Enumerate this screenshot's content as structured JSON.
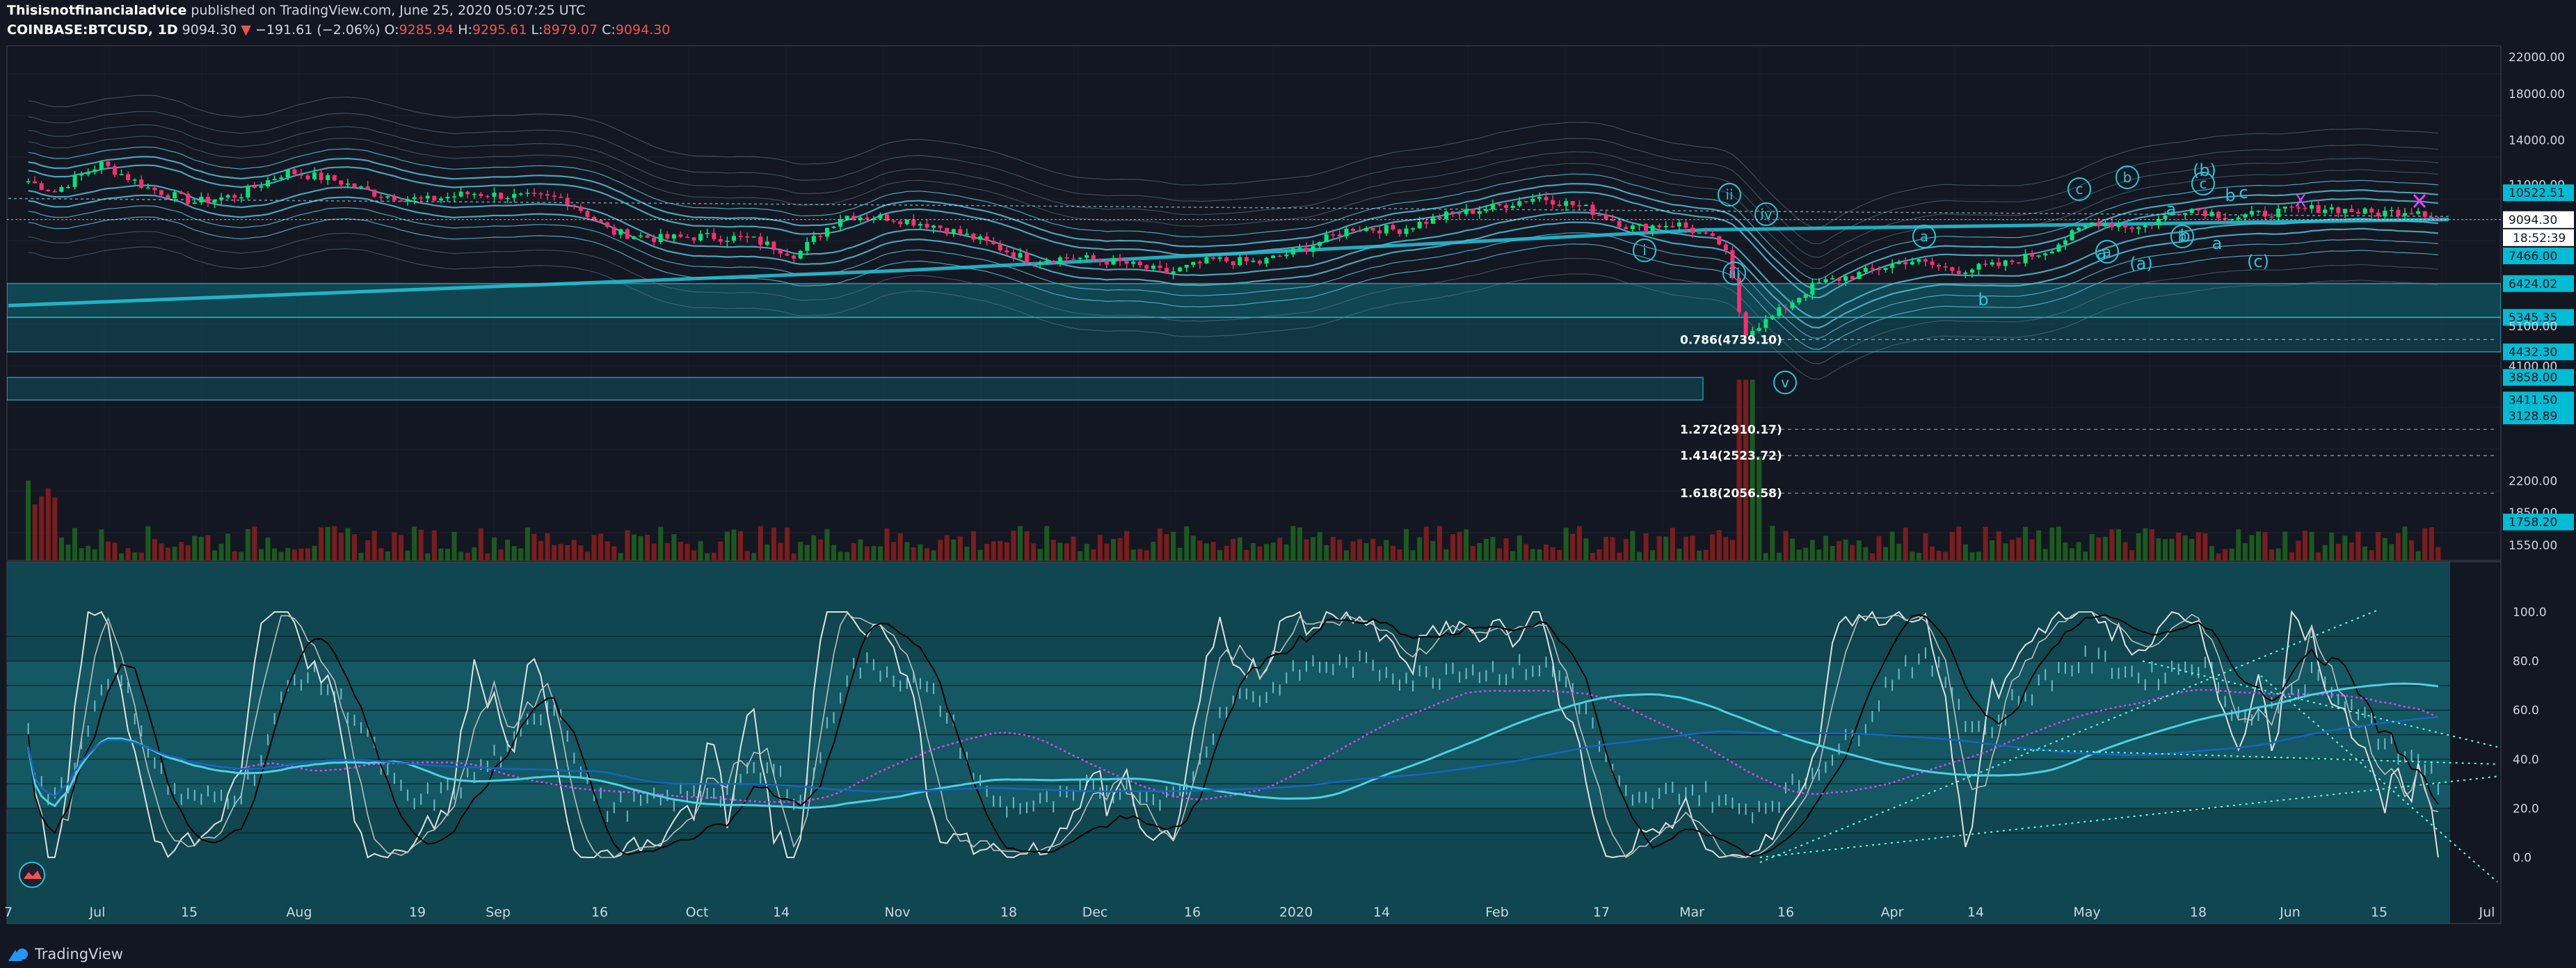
{
  "header": {
    "author": "Thisisnotfinancialadvice",
    "published": "published on TradingView.com, June 25, 2020 05:07:25 UTC",
    "symbol": "COINBASE:BTCUSD, 1D",
    "last": "9094.30",
    "change": "−191.61 (−2.06%)",
    "o_label": "O:",
    "o_val": "9285.94",
    "h_label": "H:",
    "h_val": "9295.61",
    "l_label": "L:",
    "l_val": "8979.07",
    "c_label": "C:",
    "c_val": "9094.30",
    "down_arrow": "▼"
  },
  "footer": {
    "brand": "TradingView"
  },
  "colors": {
    "background": "#131722",
    "up": "#26a69a",
    "down": "#ef5350",
    "cyan": "#26c6da",
    "volume_up": "#1b5e20",
    "volume_down": "#7f1d1d",
    "zone": "#0e6b7a",
    "magenta": "#e040fb"
  },
  "chart_data": [
    {
      "type": "candlestick",
      "symbol": "COINBASE:BTCUSD",
      "interval": "1D",
      "scale": "log",
      "y_ticks": [
        "22000.00",
        "18000.00",
        "14000.00",
        "11000.00",
        "9094.30",
        "7466.00",
        "6424.02",
        "5345.35",
        "5100.00",
        "4432.30",
        "4100.00",
        "3858.00",
        "3411.50",
        "3195.00",
        "3128.89",
        "2200.00",
        "1850.00",
        "1758.20",
        "1550.00"
      ],
      "y_ticks_highlighted": [
        "10522.51",
        "9094.30",
        "18:52:39",
        "7466.00",
        "6424.02",
        "5345.35",
        "4432.30",
        "3858.00",
        "3411.50",
        "3195.00",
        "3128.89",
        "1758.20"
      ],
      "price_label_current": "9094.30",
      "countdown": "18:52:39",
      "price_label_top": "10522.51",
      "x_ticks": [
        "7",
        "Jul",
        "15",
        "Aug",
        "19",
        "Sep",
        "16",
        "Oct",
        "14",
        "Nov",
        "18",
        "Dec",
        "16",
        "2020",
        "14",
        "Feb",
        "17",
        "Mar",
        "16",
        "Apr",
        "14",
        "May",
        "18",
        "Jun",
        "15",
        "Jul"
      ],
      "close_path": [
        [
          "2019-06-27",
          11200
        ],
        [
          "2019-07-01",
          10600
        ],
        [
          "2019-07-08",
          12300
        ],
        [
          "2019-07-15",
          10800
        ],
        [
          "2019-07-22",
          10000
        ],
        [
          "2019-07-29",
          10400
        ],
        [
          "2019-08-05",
          11800
        ],
        [
          "2019-08-12",
          11300
        ],
        [
          "2019-08-19",
          10400
        ],
        [
          "2019-08-26",
          10100
        ],
        [
          "2019-09-02",
          10500
        ],
        [
          "2019-09-09",
          10300
        ],
        [
          "2019-09-16",
          10200
        ],
        [
          "2019-09-23",
          8500
        ],
        [
          "2019-09-30",
          8200
        ],
        [
          "2019-10-07",
          8300
        ],
        [
          "2019-10-14",
          8200
        ],
        [
          "2019-10-21",
          7500
        ],
        [
          "2019-10-28",
          9300
        ],
        [
          "2019-11-04",
          9200
        ],
        [
          "2019-11-11",
          8800
        ],
        [
          "2019-11-18",
          8100
        ],
        [
          "2019-11-25",
          7300
        ],
        [
          "2019-12-02",
          7400
        ],
        [
          "2019-12-09",
          7200
        ],
        [
          "2019-12-16",
          6800
        ],
        [
          "2019-12-23",
          7300
        ],
        [
          "2019-12-30",
          7200
        ],
        [
          "2020-01-06",
          7800
        ],
        [
          "2020-01-13",
          8700
        ],
        [
          "2020-01-20",
          8600
        ],
        [
          "2020-01-27",
          9300
        ],
        [
          "2020-02-03",
          9700
        ],
        [
          "2020-02-10",
          10300
        ],
        [
          "2020-02-17",
          9700
        ],
        [
          "2020-02-24",
          8700
        ],
        [
          "2020-03-02",
          8900
        ],
        [
          "2020-03-09",
          7900
        ],
        [
          "2020-03-12",
          4900
        ],
        [
          "2020-03-16",
          5300
        ],
        [
          "2020-03-23",
          6400
        ],
        [
          "2020-03-30",
          6800
        ],
        [
          "2020-04-06",
          7300
        ],
        [
          "2020-04-13",
          6900
        ],
        [
          "2020-04-20",
          7100
        ],
        [
          "2020-04-27",
          7700
        ],
        [
          "2020-05-04",
          9000
        ],
        [
          "2020-05-11",
          8700
        ],
        [
          "2020-05-18",
          9700
        ],
        [
          "2020-05-25",
          9200
        ],
        [
          "2020-06-01",
          9500
        ],
        [
          "2020-06-08",
          9700
        ],
        [
          "2020-06-15",
          9400
        ],
        [
          "2020-06-22",
          9600
        ],
        [
          "2020-06-25",
          9094
        ]
      ],
      "fib_levels": [
        {
          "label": "0.786(4739.10)",
          "value": 4739.1
        },
        {
          "label": "1.272(2910.17)",
          "value": 2910.17
        },
        {
          "label": "1.414(2523.72)",
          "value": 2523.72
        },
        {
          "label": "1.618(2056.58)",
          "value": 2056.58
        }
      ],
      "elliott_labels": [
        "i",
        "ii",
        "iii",
        "iv",
        "v",
        "a",
        "b",
        "c",
        "b",
        "a",
        "b",
        "c",
        "a",
        "(b)",
        "(a)",
        "b",
        "a",
        "c",
        "(c)",
        "b",
        "a",
        "X"
      ],
      "zones": [
        {
          "from": 5345.35,
          "to": 6424.02
        },
        {
          "from": 4432.3,
          "to": 5345.35
        },
        {
          "from": 3411.5,
          "to": 3858.0
        }
      ],
      "legend": "none",
      "grid": true
    },
    {
      "type": "line",
      "name": "stochastic / RSI oscillator",
      "y_ticks": [
        "100.0",
        "80.0",
        "60.0",
        "40.0",
        "20.0",
        "0.0"
      ],
      "ylim": [
        0,
        100
      ],
      "horizontal_levels": [
        90,
        80,
        70,
        60,
        50,
        40,
        30,
        20,
        10
      ],
      "legend": "none",
      "grid": true
    }
  ]
}
